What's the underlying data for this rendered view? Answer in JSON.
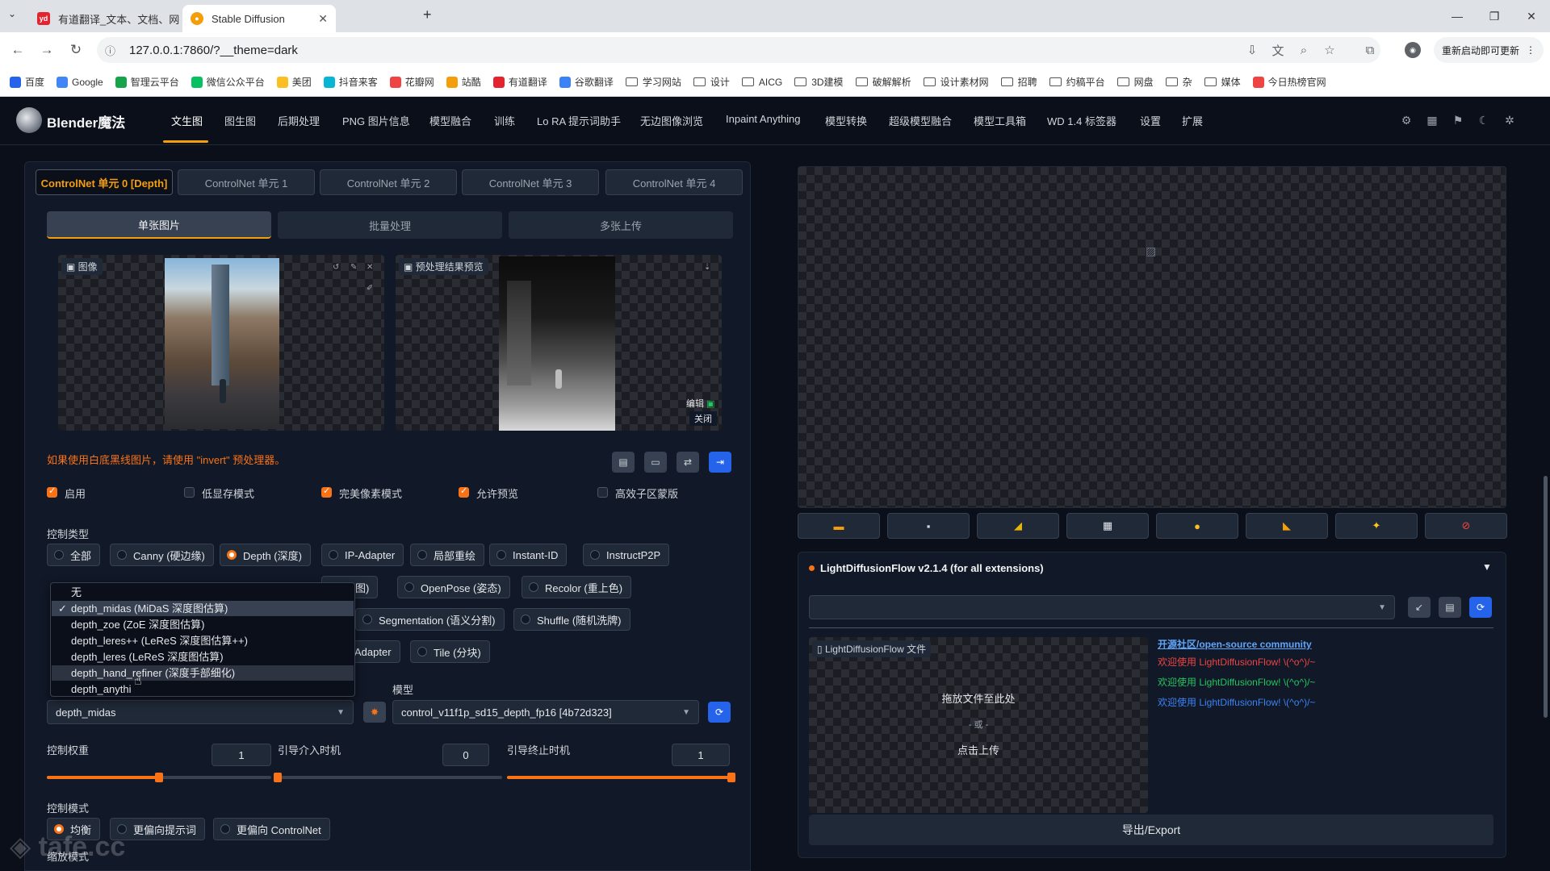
{
  "browser": {
    "tabs": [
      {
        "title": "有道翻译_文本、文档、网页、…",
        "favicon": "youdao-icon"
      },
      {
        "title": "Stable Diffusion",
        "favicon": "sd-icon"
      }
    ],
    "url": "127.0.0.1:7860/?__theme=dark",
    "update_label": "重新启动即可更新",
    "bookmarks": [
      "百度",
      "Google",
      "智理云平台",
      "微信公众平台",
      "美团",
      "抖音来客",
      "花瓣网",
      "站酷",
      "有道翻译",
      "谷歌翻译",
      "学习网站",
      "设计",
      "AICG",
      "3D建模",
      "破解解析",
      "设计素材网",
      "招聘",
      "约稿平台",
      "网盘",
      "杂",
      "媒体",
      "今日热榜官网"
    ]
  },
  "app": {
    "brand": "Blender魔法",
    "nav": [
      "文生图",
      "图生图",
      "后期处理",
      "PNG 图片信息",
      "模型融合",
      "训练",
      "Lo RA 提示词助手",
      "无边图像浏览",
      "Inpaint Anything",
      "模型转换",
      "超级模型融合",
      "模型工具箱",
      "WD 1.4 标签器",
      "设置",
      "扩展"
    ],
    "header_icons": [
      "settings-icon",
      "grid-icon",
      "pin-icon",
      "moon-icon",
      "gear-icon"
    ]
  },
  "controlnet": {
    "unit_tabs": [
      "ControlNet 单元 0 [Depth]",
      "ControlNet 单元 1",
      "ControlNet 单元 2",
      "ControlNet 单元 3",
      "ControlNet 单元 4"
    ],
    "sub_tabs": [
      "单张图片",
      "批量处理",
      "多张上传"
    ],
    "image_label": "图像",
    "preview_label": "预处理结果预览",
    "edit_label": "编辑",
    "close_label": "关闭",
    "warning": "如果使用白底黑线图片，请使用 \"invert\" 预处理器。",
    "checkboxes": [
      {
        "label": "启用",
        "checked": true
      },
      {
        "label": "低显存模式",
        "checked": false
      },
      {
        "label": "完美像素模式",
        "checked": true
      },
      {
        "label": "允许预览",
        "checked": true
      },
      {
        "label": "高效子区蒙版",
        "checked": false
      }
    ],
    "control_type_label": "控制类型",
    "control_types_row1": [
      {
        "label": "全部",
        "on": false
      },
      {
        "label": "Canny (硬边缘)",
        "on": false
      },
      {
        "label": "Depth (深度)",
        "on": true
      },
      {
        "label": "IP-Adapter",
        "on": false
      },
      {
        "label": "局部重绘",
        "on": false
      },
      {
        "label": "Instant-ID",
        "on": false
      },
      {
        "label": "InstructP2P",
        "on": false
      }
    ],
    "control_types_row2": [
      {
        "label": "线图)",
        "on": false
      },
      {
        "label": "OpenPose (姿态)",
        "on": false
      },
      {
        "label": "Recolor (重上色)",
        "on": false
      }
    ],
    "control_types_row3": [
      {
        "label": "Segmentation (语义分割)",
        "on": false
      },
      {
        "label": "Shuffle (随机洗牌)",
        "on": false
      }
    ],
    "control_types_row4": [
      {
        "label": "Adapter",
        "on": false
      },
      {
        "label": "Tile (分块)",
        "on": false
      }
    ],
    "preprocessor_options": [
      "无",
      "depth_midas (MiDaS 深度图估算)",
      "depth_zoe (ZoE 深度图估算)",
      "depth_leres++ (LeReS 深度图估算++)",
      "depth_leres (LeReS 深度图估算)",
      "depth_hand_refiner (深度手部细化)",
      "depth_anythi"
    ],
    "preprocessor_selected": "depth_midas",
    "model_label": "模型",
    "model_value": "control_v11f1p_sd15_depth_fp16 [4b72d323]",
    "weight_label": "控制权重",
    "weight_value": "1",
    "start_label": "引导介入时机",
    "start_value": "0",
    "end_label": "引导终止时机",
    "end_value": "1",
    "weight_level": 0.5,
    "start_level": 0.0,
    "end_level": 1.0,
    "mode_label": "控制模式",
    "modes": [
      {
        "label": "均衡",
        "on": true
      },
      {
        "label": "更偏向提示词",
        "on": false
      },
      {
        "label": "更偏向 ControlNet",
        "on": false
      }
    ],
    "resize_label": "缩放模式"
  },
  "right": {
    "tool_icons": [
      "folder-icon",
      "save-icon",
      "zip-icon",
      "image-icon",
      "palette-icon",
      "ruler-icon",
      "star-icon",
      "stop-icon"
    ],
    "ldf_title": "LightDiffusionFlow v2.1.4 (for all extensions)",
    "ldf_file_label": "LightDiffusionFlow 文件",
    "drop_text": "拖放文件至此处",
    "or_text": "- 或 -",
    "upload_text": "点击上传",
    "community_link": "开源社区/open-source community",
    "welcome_lines": [
      {
        "text": "欢迎使用 LightDiffusionFlow! \\(^o^)/~",
        "color": "#ef4444"
      },
      {
        "text": "欢迎使用 LightDiffusionFlow! \\(^o^)/~",
        "color": "#22c55e"
      },
      {
        "text": "欢迎使用 LightDiffusionFlow! \\(^o^)/~",
        "color": "#3b82f6"
      }
    ],
    "export_label": "导出/Export"
  },
  "watermark": "tafe.cc",
  "colors": {
    "accent": "#f97316",
    "link": "#3b82f6",
    "bg": "#0b0f19"
  }
}
